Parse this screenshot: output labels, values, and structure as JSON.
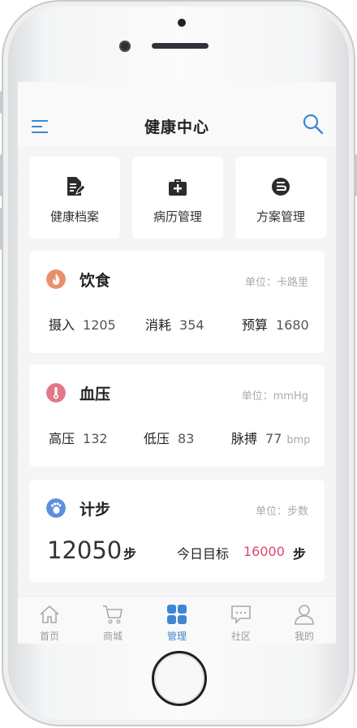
{
  "header": {
    "title": "健康中心"
  },
  "quick_actions": [
    {
      "label": "健康档案",
      "icon": "document-edit-icon"
    },
    {
      "label": "病历管理",
      "icon": "medical-kit-icon"
    },
    {
      "label": "方案管理",
      "icon": "plan-icon"
    }
  ],
  "diet": {
    "title": "饮食",
    "unit": "单位：卡路里",
    "icon": "fire-icon",
    "icon_color": "#e9906a",
    "metrics": [
      {
        "label": "摄入",
        "value": "1205"
      },
      {
        "label": "消耗",
        "value": "354"
      },
      {
        "label": "预算",
        "value": "1680"
      }
    ]
  },
  "blood_pressure": {
    "title": "血压",
    "unit": "单位：mmHg",
    "icon": "thermometer-icon",
    "icon_color": "#e07a8a",
    "metrics": [
      {
        "label": "高压",
        "value": "132"
      },
      {
        "label": "低压",
        "value": "83"
      },
      {
        "label": "脉搏",
        "value": "77",
        "suffix": "bmp"
      }
    ]
  },
  "steps": {
    "title": "计步",
    "unit": "单位：步数",
    "icon": "footprint-icon",
    "icon_color": "#5d8fdc",
    "count": "12050",
    "count_unit": "步",
    "goal_label": "今日目标",
    "goal_value": "16000",
    "goal_unit": "步"
  },
  "tabbar": [
    {
      "label": "首页",
      "icon": "home-icon"
    },
    {
      "label": "商城",
      "icon": "cart-icon"
    },
    {
      "label": "管理",
      "icon": "grid-icon",
      "active": true
    },
    {
      "label": "社区",
      "icon": "chat-icon"
    },
    {
      "label": "我的",
      "icon": "user-icon"
    }
  ],
  "colors": {
    "accent": "#3f86d6",
    "goal": "#e0466e"
  }
}
